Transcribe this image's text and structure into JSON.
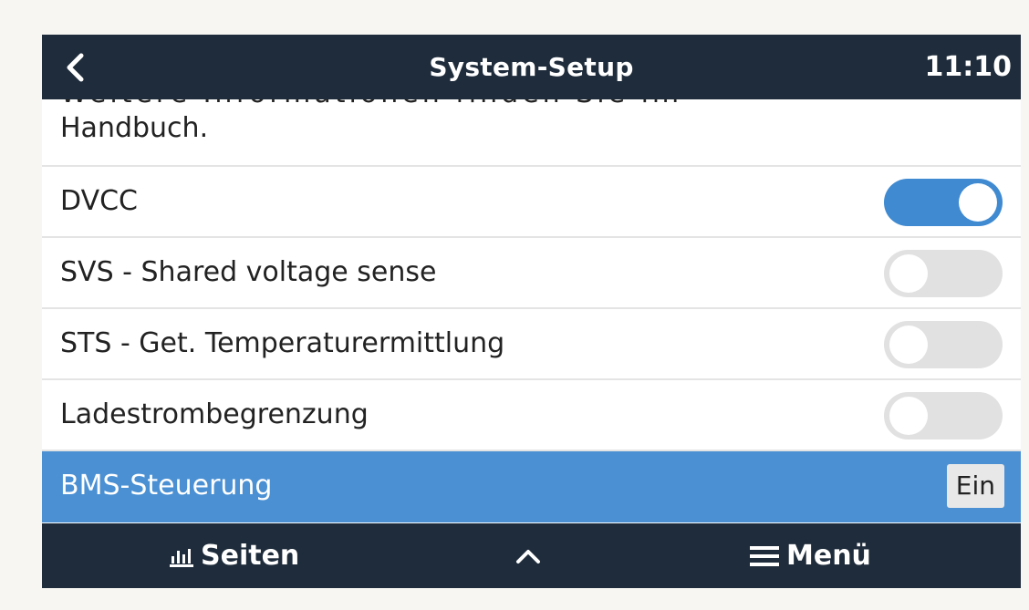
{
  "header": {
    "title": "System-Setup",
    "time": "11:10",
    "back_icon": "chevron-left-icon"
  },
  "description": {
    "partial_line": "Weitere Informationen finden Sie im",
    "text": "Handbuch."
  },
  "settings": [
    {
      "label": "DVCC",
      "type": "toggle",
      "on": true
    },
    {
      "label": "SVS - Shared voltage sense",
      "type": "toggle",
      "on": false
    },
    {
      "label": "STS - Get. Temperaturermittlung",
      "type": "toggle",
      "on": false
    },
    {
      "label": "Ladestrombegrenzung",
      "type": "toggle",
      "on": false
    },
    {
      "label": "BMS-Steuerung",
      "type": "value",
      "value": "Ein",
      "selected": true
    }
  ],
  "footer": {
    "pages_label": "Seiten",
    "pages_icon": "bar-chart-icon",
    "up_icon": "chevron-up-icon",
    "menu_label": "Menü",
    "menu_icon": "hamburger-menu-icon"
  },
  "colors": {
    "header_bg": "#1f2c3b",
    "toggle_on": "#3f8ad1",
    "toggle_off": "#e1e1e1",
    "selected_row": "#4a90d3"
  }
}
